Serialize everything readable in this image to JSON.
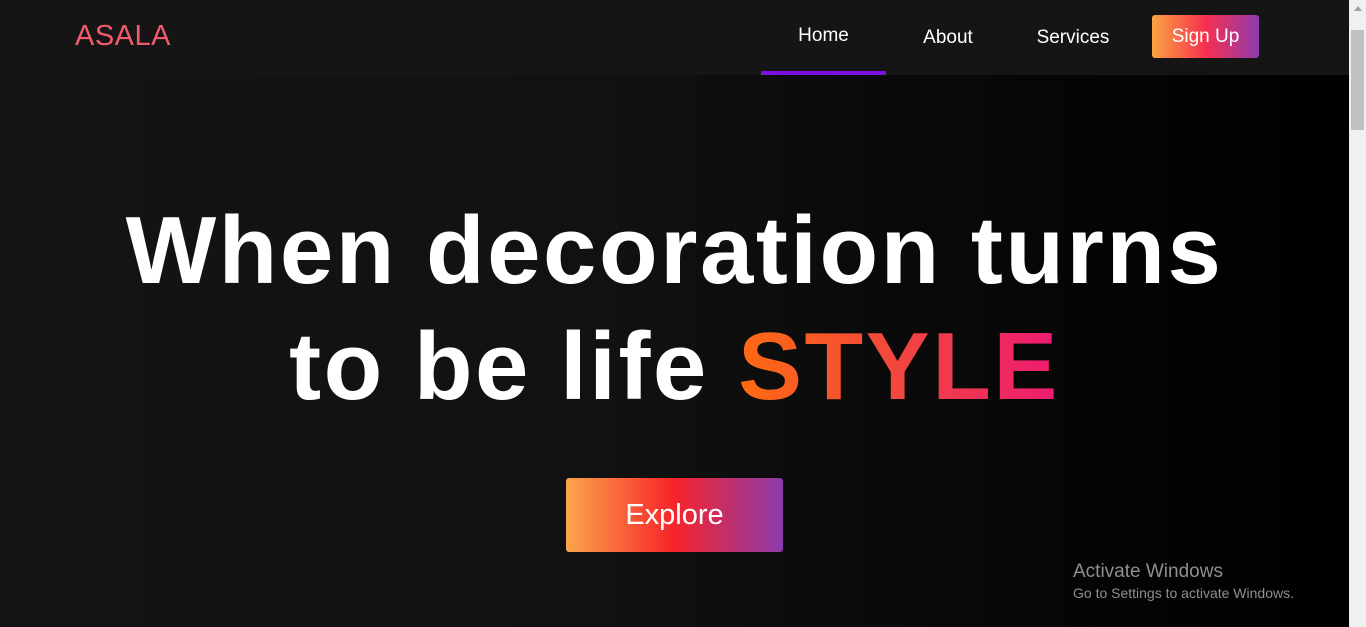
{
  "nav": {
    "logo": "ASALA",
    "links": [
      {
        "label": "Home",
        "active": true
      },
      {
        "label": "About",
        "active": false
      },
      {
        "label": "Services",
        "active": false
      }
    ],
    "signup_label": "Sign Up"
  },
  "hero": {
    "title_line1": "When decoration turns",
    "title_line2_prefix": "to be life ",
    "title_accent": "STYLE",
    "explore_label": "Explore"
  },
  "watermark": {
    "title": "Activate Windows",
    "subtitle": "Go to Settings to activate Windows."
  },
  "colors": {
    "logo": "#f25a6e",
    "active_underline": "#7d10e0",
    "button_gradient": [
      "#fca54b",
      "#f6242a",
      "#8b3aad"
    ],
    "accent_gradient": [
      "#ff6a12",
      "#ec1a72"
    ],
    "background": "#121212"
  }
}
